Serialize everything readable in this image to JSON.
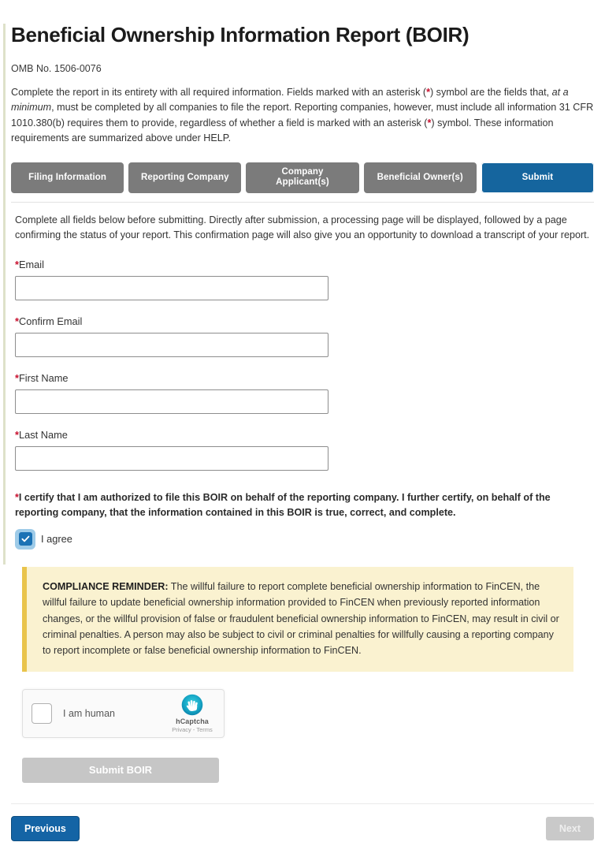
{
  "header": {
    "title": "Beneficial Ownership Information Report (BOIR)",
    "omb": "OMB No. 1506-0076",
    "intro_part1": "Complete the report in its entirety with all required information. Fields marked with an asterisk (",
    "intro_ast1": "*",
    "intro_part2": ") symbol are the fields that, ",
    "intro_em": "at a minimum",
    "intro_part3": ", must be completed by all companies to file the report. Reporting companies, however, must include all information 31 CFR 1010.380(b) requires them to provide, regardless of whether a field is marked with an asterisk (",
    "intro_ast2": "*",
    "intro_part4": ") symbol. These information requirements are summarized above under HELP."
  },
  "tabs": [
    {
      "label": "Filing Information",
      "active": false
    },
    {
      "label": "Reporting Company",
      "active": false
    },
    {
      "label": "Company\nApplicant(s)",
      "active": false
    },
    {
      "label": "Beneficial Owner(s)",
      "active": false
    },
    {
      "label": "Submit",
      "active": true
    }
  ],
  "main": {
    "blurb": "Complete all fields below before submitting. Directly after submission, a processing page will be displayed, followed by a page confirming the status of your report. This confirmation page will also give you an opportunity to download a transcript of your report."
  },
  "fields": [
    {
      "label_ast": "*",
      "label": "Email",
      "value": "",
      "placeholder": ""
    },
    {
      "label_ast": "*",
      "label": "Confirm Email",
      "value": "",
      "placeholder": ""
    },
    {
      "label_ast": "*",
      "label": "First Name",
      "value": "",
      "placeholder": ""
    },
    {
      "label_ast": "*",
      "label": "Last Name",
      "value": "",
      "placeholder": ""
    }
  ],
  "certification": {
    "asterisk": "*",
    "text": "I certify that I am authorized to file this BOIR on behalf of the reporting company. I further certify, on behalf of the reporting company, that the information contained in this BOIR is true, correct, and complete.",
    "agree_label": "I agree",
    "checked": true
  },
  "compliance": {
    "heading": "COMPLIANCE REMINDER:",
    "text": " The willful failure to report complete beneficial ownership information to FinCEN, the willful failure to update beneficial ownership information provided to FinCEN when previously reported information changes, or the willful provision of false or fraudulent beneficial ownership information to FinCEN, may result in civil or criminal penalties. A person may also be subject to civil or criminal penalties for willfully causing a reporting company to report incomplete or false beneficial ownership information to FinCEN."
  },
  "captcha": {
    "label": "I am human",
    "brand": "hCaptcha",
    "legal": "Privacy - Terms",
    "checked": false
  },
  "actions": {
    "submit_boir": "Submit BOIR",
    "previous": "Previous",
    "next": "Next"
  },
  "colors": {
    "tab_inactive": "#7b7b7b",
    "tab_active": "#15659e",
    "asterisk_red": "#c8102e",
    "compliance_bg": "#faf2d0",
    "compliance_border": "#e9c44c",
    "primary_blue": "#1464a5",
    "disabled_gray": "#c6c6c6",
    "checkbox_blue": "#1b72b5"
  }
}
